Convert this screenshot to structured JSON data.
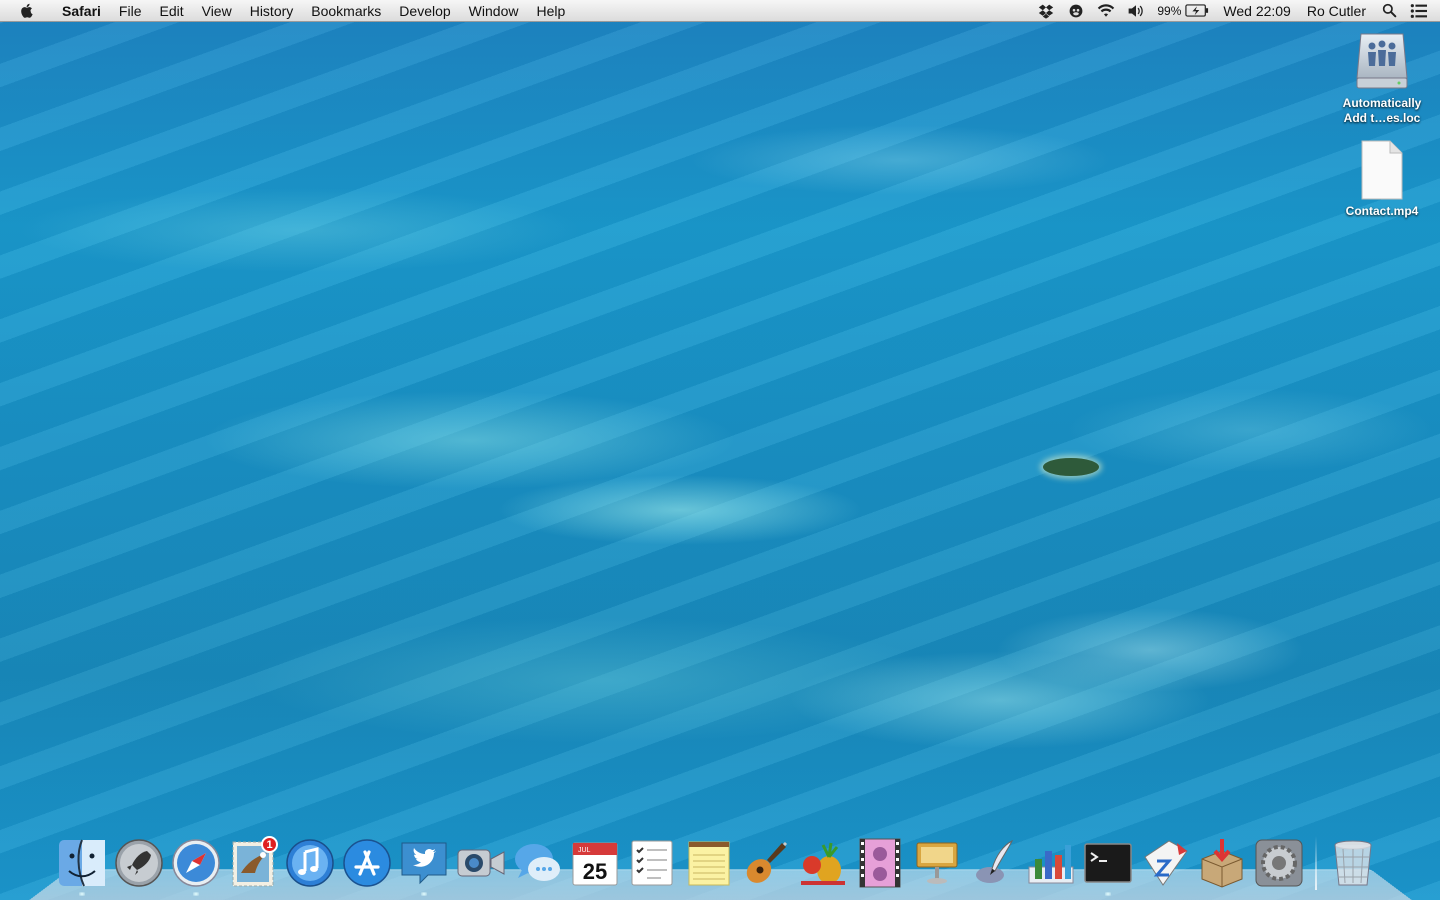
{
  "menubar": {
    "app_name": "Safari",
    "menus": [
      "File",
      "Edit",
      "View",
      "History",
      "Bookmarks",
      "Develop",
      "Window",
      "Help"
    ],
    "battery": "99%",
    "clock": "Wed 22:09",
    "user": "Ro Cutler"
  },
  "desktop_icons": [
    {
      "label_line1": "Automatically",
      "label_line2": "Add t…es.loc"
    },
    {
      "label_line1": "Contact.mp4",
      "label_line2": ""
    }
  ],
  "dock": {
    "apps": [
      "Finder",
      "Launchpad",
      "Safari",
      "Mail",
      "iTunes",
      "App Store",
      "Twitter",
      "FaceTime",
      "Messages",
      "Calendar",
      "Reminders",
      "Notes",
      "GarageBand",
      "Frenzic",
      "Photo Booth",
      "Keynote",
      "Script Editor",
      "Numbers",
      "Terminal",
      "MetaZ",
      "Installer",
      "System Preferences",
      "Trash"
    ],
    "mail_badge": "1",
    "calendar_month": "JUL",
    "calendar_day": "25"
  },
  "colors": {
    "menubar": "#e8e8e8",
    "ocean": "#1a93c6",
    "badge": "#e02020"
  }
}
